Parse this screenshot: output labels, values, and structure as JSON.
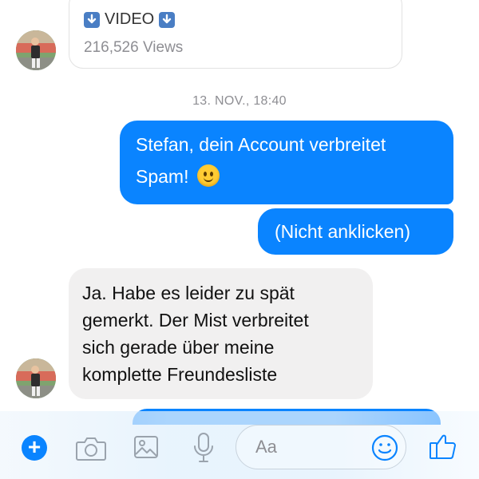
{
  "card": {
    "title": "VIDEO",
    "views": "216,526 Views"
  },
  "timestamp": "13. NOV., 18:40",
  "messages": [
    {
      "direction": "outgoing",
      "lines": [
        "Stefan, dein Account verbreitet",
        "Spam!"
      ],
      "emoji": "slightly-smiling-face"
    },
    {
      "direction": "outgoing",
      "lines": [
        "(Nicht anklicken)"
      ]
    },
    {
      "direction": "incoming",
      "lines": [
        "Ja. Habe es leider zu spät",
        "gemerkt. Der Mist verbreitet",
        "sich gerade über meine",
        "komplette Freundesliste"
      ]
    }
  ],
  "composer": {
    "placeholder": "Aa",
    "icons": [
      "plus-icon",
      "camera-icon",
      "image-icon",
      "microphone-icon",
      "emoji-icon",
      "thumbs-up-icon"
    ]
  },
  "colors": {
    "accent": "#0a84ff",
    "incoming_bubble": "#f1f0f0",
    "meta_text": "#8e8e93"
  }
}
